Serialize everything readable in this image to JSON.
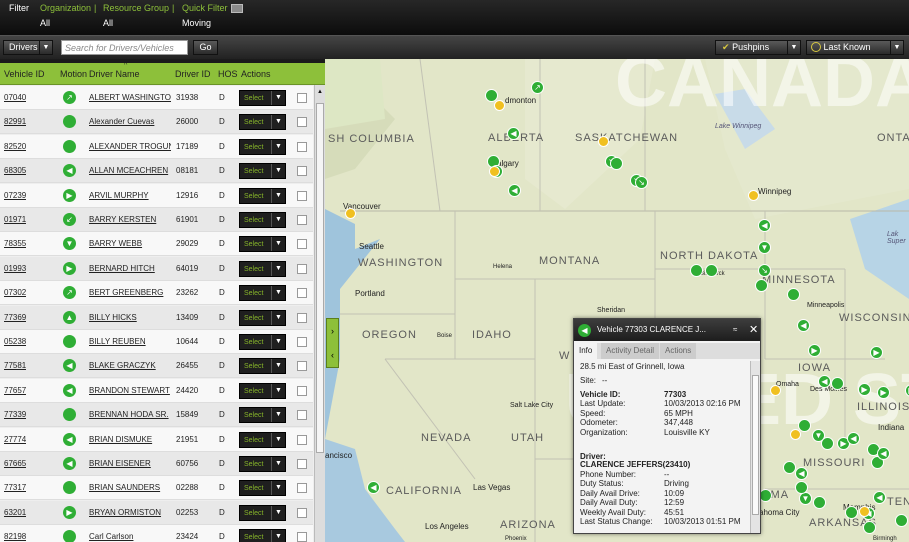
{
  "filter": {
    "label": "Filter",
    "organization_label": "Organization",
    "organization_value": "All",
    "resource_label": "Resource Group",
    "resource_value": "All",
    "quick_label": "Quick Filter",
    "quick_value": "Moving",
    "filter_value": "All",
    "separator": "|"
  },
  "toolbar": {
    "type_select": "Drivers",
    "search_placeholder": "Search for Drivers/Vehicles",
    "go": "Go",
    "pushpins": "Pushpins",
    "last_known": "Last Known"
  },
  "table": {
    "headers": [
      "Vehicle ID",
      "Motion",
      "Driver Name",
      "Driver ID",
      "HOS",
      "Actions"
    ],
    "select_label": "Select",
    "rows": [
      {
        "vehicle": "07040",
        "driver": "ALBERT WASHINGTON",
        "id": "31938",
        "hos": "D",
        "motion": "up-right"
      },
      {
        "vehicle": "82991",
        "driver": "Alexander Cuevas",
        "id": "26000",
        "hos": "D",
        "motion": "stopped"
      },
      {
        "vehicle": "82520",
        "driver": "ALEXANDER TROGUN",
        "id": "17189",
        "hos": "D",
        "motion": "stopped"
      },
      {
        "vehicle": "68305",
        "driver": "ALLAN MCEACHREN",
        "id": "08181",
        "hos": "D",
        "motion": "left"
      },
      {
        "vehicle": "07239",
        "driver": "ARVIL MURPHY",
        "id": "12916",
        "hos": "D",
        "motion": "right"
      },
      {
        "vehicle": "01971",
        "driver": "BARRY KERSTEN",
        "id": "61901",
        "hos": "D",
        "motion": "down-left"
      },
      {
        "vehicle": "78355",
        "driver": "BARRY WEBB",
        "id": "29029",
        "hos": "D",
        "motion": "down"
      },
      {
        "vehicle": "01993",
        "driver": "BERNARD HITCH",
        "id": "64019",
        "hos": "D",
        "motion": "right"
      },
      {
        "vehicle": "07302",
        "driver": "BERT GREENBERG",
        "id": "23262",
        "hos": "D",
        "motion": "up-right"
      },
      {
        "vehicle": "77369",
        "driver": "BILLY HICKS",
        "id": "13409",
        "hos": "D",
        "motion": "up"
      },
      {
        "vehicle": "05238",
        "driver": "BILLY REUBEN",
        "id": "10644",
        "hos": "D",
        "motion": "stopped"
      },
      {
        "vehicle": "77581",
        "driver": "BLAKE GRACZYK",
        "id": "26455",
        "hos": "D",
        "motion": "left"
      },
      {
        "vehicle": "77657",
        "driver": "BRANDON STEWART",
        "id": "24420",
        "hos": "D",
        "motion": "left"
      },
      {
        "vehicle": "77339",
        "driver": "BRENNAN HODA SR.",
        "id": "15849",
        "hos": "D",
        "motion": "stopped"
      },
      {
        "vehicle": "27774",
        "driver": "BRIAN DISMUKE",
        "id": "21951",
        "hos": "D",
        "motion": "left"
      },
      {
        "vehicle": "67665",
        "driver": "BRIAN EISENER",
        "id": "60756",
        "hos": "D",
        "motion": "left"
      },
      {
        "vehicle": "77317",
        "driver": "BRIAN SAUNDERS",
        "id": "02288",
        "hos": "D",
        "motion": "stopped"
      },
      {
        "vehicle": "63201",
        "driver": "BRYAN ORMISTON",
        "id": "02253",
        "hos": "D",
        "motion": "right"
      },
      {
        "vehicle": "82198",
        "driver": "Carl Carlson",
        "id": "23424",
        "hos": "D",
        "motion": "stopped"
      }
    ]
  },
  "map": {
    "watermark": [
      "CANADA",
      "UNITED STATES"
    ],
    "regions": [
      "ALBERTA",
      "SASKATCHEWAN",
      "ONTA",
      "SH COLUMBIA",
      "WASHINGTON",
      "MONTANA",
      "NORTH DAKOTA",
      "MINNESOTA",
      "OREGON",
      "IDAHO",
      "WISCONSIN",
      "IOWA",
      "NEVADA",
      "UTAH",
      "CALIFORNIA",
      "ARIZONA",
      "MISSOURI",
      "ILLINOIS",
      "ARKANSAS",
      "TEN",
      "OMA",
      "W"
    ],
    "cities": [
      "dmonton",
      "algary",
      "Vancouver",
      "Seattle",
      "Portland",
      "Winnipeg",
      "Lake Winnipeg",
      "Helena",
      "Bismarck",
      "Minneapolis",
      "Sheridan",
      "Boise",
      "Salt Lake City",
      "Las Vegas",
      "Los Angeles",
      "ancisco",
      "Omaha",
      "Des Moines",
      "Memphis",
      "Indiana",
      "ahoma City",
      "Lak Super",
      "Phoenix",
      "Birmingh"
    ]
  },
  "popup": {
    "title": "Vehicle 77303  CLARENCE J...",
    "expand": "≈",
    "close": "✕",
    "tabs": [
      "Info",
      "Activity Detail",
      "Actions"
    ],
    "location": "28.5 mi East of Grinnell, Iowa",
    "site_label": "Site:",
    "site_value": "--",
    "fields": [
      {
        "label": "Vehicle ID:",
        "value": "77303",
        "bold": true
      },
      {
        "label": "Last Update:",
        "value": "10/03/2013 02:16 PM"
      },
      {
        "label": "Speed:",
        "value": "65 MPH"
      },
      {
        "label": "Odometer:",
        "value": "347,448"
      },
      {
        "label": "Organization:",
        "value": "Louisville KY"
      }
    ],
    "driver_label": "Driver:",
    "driver_name": "CLARENCE JEFFERS(23410)",
    "driver_fields": [
      {
        "label": "Phone Number:",
        "value": "--"
      },
      {
        "label": "Duty Status:",
        "value": "Driving"
      },
      {
        "label": "Daily Avail Drive:",
        "value": "10:09"
      },
      {
        "label": "Daily Avail Duty:",
        "value": "12:59"
      },
      {
        "label": "Weekly Avail Duty:",
        "value": "45:51"
      },
      {
        "label": "Last Status Change:",
        "value": "10/03/2013 01:51 PM"
      }
    ]
  },
  "colors": {
    "accent": "#8dc03a",
    "pin_green": "#2fae35",
    "city_pin": "#f0c020"
  }
}
